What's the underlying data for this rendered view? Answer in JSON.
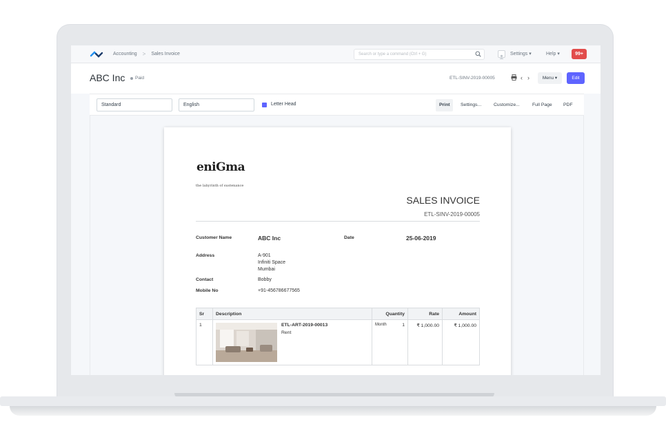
{
  "navbar": {
    "breadcrumbs": [
      "Accounting",
      "Sales Invoice"
    ],
    "search_placeholder": "Search or type a command (Ctrl + G)",
    "settings_label": "Settings",
    "help_label": "Help",
    "notifications_badge": "99+"
  },
  "page": {
    "title": "ABC Inc",
    "status": "Paid",
    "doc_name": "ETL-SINV-2019-00005",
    "menu_label": "Menu",
    "edit_label": "Edit"
  },
  "print_toolbar": {
    "format_value": "Standard",
    "language_value": "English",
    "letter_head_label": "Letter Head",
    "letter_head_checked": true,
    "buttons": [
      "Print",
      "Settings...",
      "Customize...",
      "Full Page",
      "PDF"
    ]
  },
  "invoice": {
    "brand": "eniGma",
    "tagline": "the labyrinth of sustenance",
    "heading": "SALES INVOICE",
    "number": "ETL-SINV-2019-00005",
    "customer_label": "Customer Name",
    "customer_value": "ABC Inc",
    "date_label": "Date",
    "date_value": "25-06-2019",
    "address_label": "Address",
    "address_lines": [
      "A-901",
      "Infiniti Space",
      "Mumbai"
    ],
    "contact_label": "Contact",
    "contact_value": "Bobby",
    "mobile_label": "Mobile No",
    "mobile_value": "+91-456786677565",
    "table_headers": [
      "Sr",
      "Description",
      "Quantity",
      "Rate",
      "Amount"
    ],
    "items": [
      {
        "sr": "1",
        "code": "ETL-ART-2019-00013",
        "name": "Rent",
        "uom": "Month",
        "qty": "1",
        "rate": "₹ 1,000.00",
        "amount": "₹ 1,000.00"
      }
    ]
  },
  "colors": {
    "primary": "#5e64ff",
    "badge": "#e24c4b"
  }
}
